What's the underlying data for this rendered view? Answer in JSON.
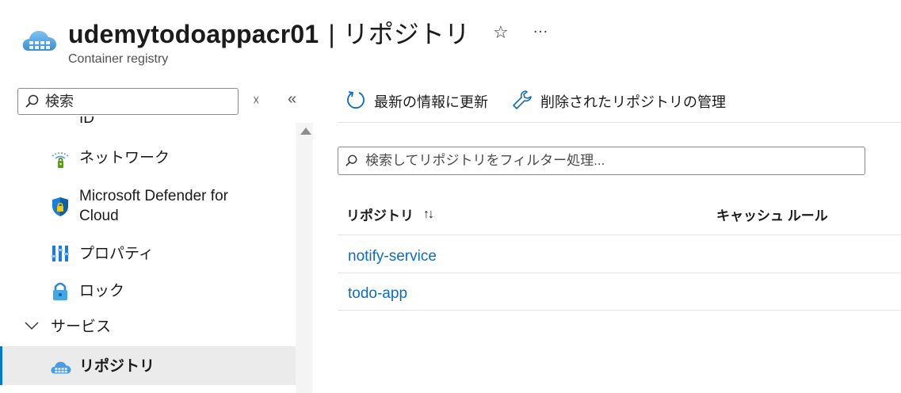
{
  "header": {
    "resource_name": "udemytodoappacr01",
    "separator": "|",
    "page_title": "リポジトリ",
    "subtitle": "Container registry",
    "favorite_icon": "☆",
    "more_icon": "…"
  },
  "sidebar": {
    "search_placeholder": "検索",
    "clear_icon": "☓",
    "collapse_icon": "«",
    "items": [
      {
        "label": "ID",
        "icon": "identity-icon"
      },
      {
        "label": "ネットワーク",
        "icon": "network-icon"
      },
      {
        "label": "Microsoft Defender for Cloud",
        "icon": "defender-shield-icon"
      },
      {
        "label": "プロパティ",
        "icon": "properties-icon"
      },
      {
        "label": "ロック",
        "icon": "lock-icon"
      }
    ],
    "group": {
      "label": "サービス",
      "expanded": true
    },
    "selected_item": {
      "label": "リポジトリ",
      "icon": "container-registry-icon"
    }
  },
  "toolbar": {
    "refresh_label": "最新の情報に更新",
    "manage_deleted_label": "削除されたリポジトリの管理"
  },
  "filter": {
    "placeholder": "検索してリポジトリをフィルター処理..."
  },
  "table": {
    "columns": [
      "リポジトリ",
      "キャッシュ ルール"
    ],
    "sort_icon": "↑↓",
    "rows": [
      {
        "repository": "notify-service",
        "cache_rule": ""
      },
      {
        "repository": "todo-app",
        "cache_rule": ""
      }
    ]
  },
  "colors": {
    "accent": "#0078d4",
    "link": "#0f6cbd",
    "selected_bg": "#ebebeb"
  }
}
